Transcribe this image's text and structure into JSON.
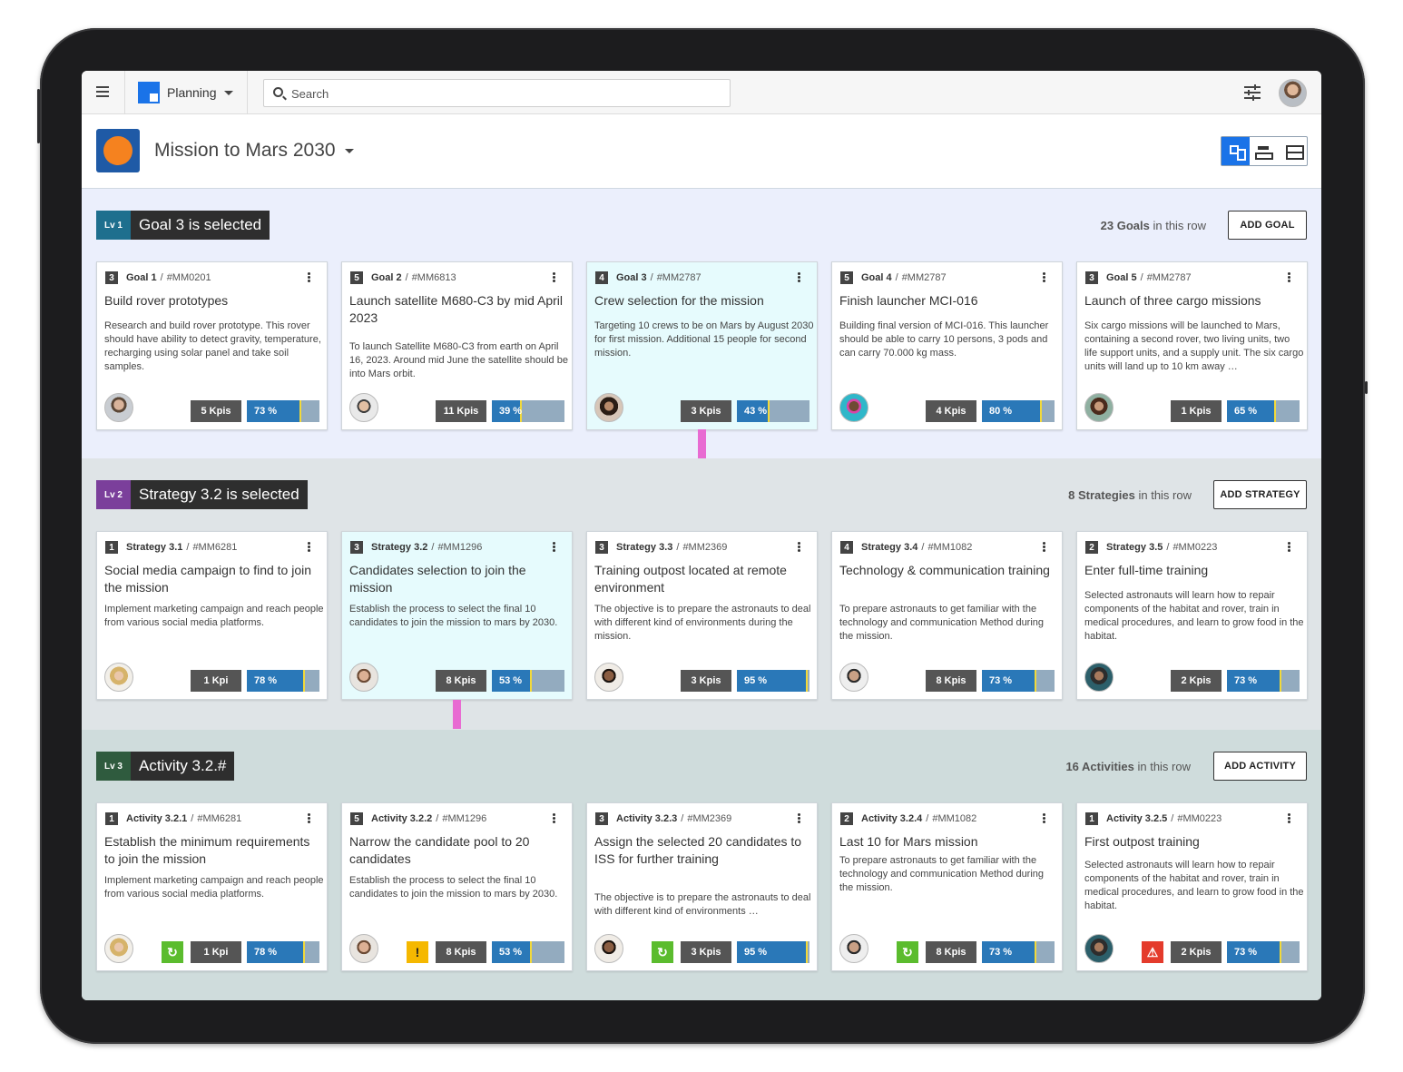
{
  "app": {
    "name": "Planning"
  },
  "search": {
    "placeholder": "Search"
  },
  "project": {
    "title": "Mission to Mars 2030"
  },
  "colors": {
    "accent": "#1a73e8",
    "lv1_badge": "#1e6f8e",
    "lv2_badge": "#7b3f9b",
    "lv3_badge": "#2f5b3e",
    "connector": "#e86bd2",
    "selected_card": "#e6fbfd"
  },
  "levels": [
    {
      "badge": "Lv 1",
      "title": "Goal 3 is selected",
      "count_num": "23 Goals",
      "count_suffix": " in this row",
      "add_label": "ADD GOAL",
      "cards": [
        {
          "num": "3",
          "name": "Goal 1",
          "code": "#MM0201",
          "title": "Build rover prototypes",
          "desc": "Research and build rover prototype. This rover should have ability to detect gravity, temperature, recharging using solar panel and take soil samples.",
          "kpis": "5 Kpis",
          "progress": "73 %",
          "avatar": "avatar-man-beard"
        },
        {
          "num": "5",
          "name": "Goal 2",
          "code": "#MM6813",
          "title": "Launch satellite M680-C3 by mid April 2023",
          "desc": "To launch Satellite M680-C3 from earth on April 16, 2023. Around mid June the satellite should be into Mars orbit.",
          "kpis": "11 Kpis",
          "progress": "39 %",
          "avatar": "avatar-man-cap"
        },
        {
          "num": "4",
          "name": "Goal 3",
          "code": "#MM2787",
          "title": "Crew selection for the mission",
          "desc": "Targeting 10 crews to be on Mars by August 2030 for first mission. Additional 15 people for second mission.",
          "kpis": "3 Kpis",
          "progress": "43 %",
          "avatar": "avatar-woman-dark-hair"
        },
        {
          "num": "5",
          "name": "Goal 4",
          "code": "#MM2787",
          "title": "Finish launcher MCI-016",
          "desc": "Building final version of MCI-016. This launcher should be able to carry 10 persons, 3 pods and can carry 70.000 kg mass.",
          "kpis": "4 Kpis",
          "progress": "80 %",
          "avatar": "avatar-man-colorful"
        },
        {
          "num": "3",
          "name": "Goal 5",
          "code": "#MM2787",
          "title": "Launch of three cargo missions",
          "desc": "Six cargo missions will be launched to Mars, containing a second rover, two living units, two life support units, and a supply unit. The six cargo units will land up to 10 km away …",
          "kpis": "1 Kpis",
          "progress": "65 %",
          "avatar": "avatar-woman-curly"
        }
      ]
    },
    {
      "badge": "Lv 2",
      "title": "Strategy 3.2 is selected",
      "count_num": "8 Strategies",
      "count_suffix": " in this row",
      "add_label": "ADD STRATEGY",
      "cards": [
        {
          "num": "1",
          "name": "Strategy 3.1",
          "code": "#MM6281",
          "title": "Social media campaign to find to join the mission",
          "desc": "Implement marketing campaign and reach people from various social media platforms.",
          "kpis": "1 Kpi",
          "progress": "78 %",
          "avatar": "avatar-woman-blonde"
        },
        {
          "num": "3",
          "name": "Strategy 3.2",
          "code": "#MM1296",
          "title": "Candidates selection to join the mission",
          "desc": "Establish the process to select the final 10 candidates to join the mission to mars by 2030.",
          "kpis": "8 Kpis",
          "progress": "53 %",
          "avatar": "avatar-man-short-hair"
        },
        {
          "num": "3",
          "name": "Strategy 3.3",
          "code": "#MM2369",
          "title": "Training outpost located at remote environment",
          "desc": "The objective is to prepare the astronauts to deal with different kind of environments during the mission.",
          "kpis": "3 Kpis",
          "progress": "95 %",
          "avatar": "avatar-man-dark"
        },
        {
          "num": "4",
          "name": "Strategy 3.4",
          "code": "#MM1082",
          "title": "Technology & communication training",
          "desc": "To prepare astronauts to get familiar with the technology and communication Method during the mission.",
          "kpis": "8 Kpis",
          "progress": "73 %",
          "avatar": "avatar-man-sunglasses"
        },
        {
          "num": "2",
          "name": "Strategy 3.5",
          "code": "#MM0223",
          "title": "Enter full-time training",
          "desc": "Selected astronauts will learn how to repair components of the habitat and rover, train in medical procedures, and learn to grow food in the habitat.",
          "kpis": "2 Kpis",
          "progress": "73 %",
          "avatar": "avatar-woman-teal"
        }
      ]
    },
    {
      "badge": "Lv 3",
      "title": "Activity 3.2.#",
      "count_num": "16 Activities",
      "count_suffix": " in this row",
      "add_label": "ADD ACTIVITY",
      "cards": [
        {
          "num": "1",
          "name": "Activity 3.2.1",
          "code": "#MM6281",
          "title": "Establish the minimum requirements to join the mission",
          "desc": "Implement marketing campaign and reach people from various social media platforms.",
          "status": "refresh-icon",
          "kpis": "1 Kpi",
          "progress": "78 %",
          "avatar": "avatar-woman-blonde"
        },
        {
          "num": "5",
          "name": "Activity 3.2.2",
          "code": "#MM1296",
          "title": "Narrow the candidate pool to 20 candidates",
          "desc": "Establish the process to select the final 10 candidates to join the mission to mars by 2030.",
          "status": "exclamation-icon",
          "kpis": "8 Kpis",
          "progress": "53 %",
          "avatar": "avatar-man-short-hair"
        },
        {
          "num": "3",
          "name": "Activity 3.2.3",
          "code": "#MM2369",
          "title": "Assign the selected 20 candidates to ISS for further training",
          "desc": "The objective is to prepare the astronauts to deal with different kind of environments …",
          "status": "refresh-icon",
          "kpis": "3 Kpis",
          "progress": "95 %",
          "avatar": "avatar-man-dark"
        },
        {
          "num": "2",
          "name": "Activity 3.2.4",
          "code": "#MM1082",
          "title": "Last 10 for Mars mission",
          "desc": "To prepare astronauts to get familiar with the technology and communication Method during the mission.",
          "status": "refresh-icon",
          "kpis": "8 Kpis",
          "progress": "73 %",
          "avatar": "avatar-man-sunglasses"
        },
        {
          "num": "1",
          "name": "Activity 3.2.5",
          "code": "#MM0223",
          "title": "First outpost training",
          "desc": "Selected astronauts will learn how to repair components of the habitat and rover, train in medical procedures, and learn to grow food in the habitat.",
          "status": "warning-triangle-icon",
          "kpis": "2 Kpis",
          "progress": "73 %",
          "avatar": "avatar-woman-teal"
        }
      ]
    }
  ]
}
